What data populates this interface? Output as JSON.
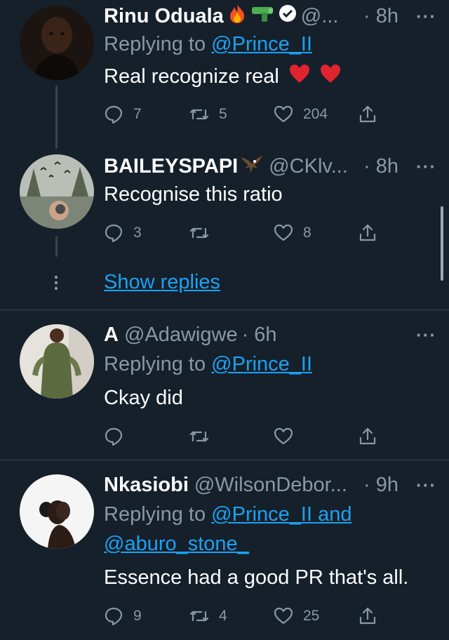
{
  "tweets": [
    {
      "name": "Rinu Oduala",
      "handle": "@...",
      "time": "· 8h",
      "replying_prefix": "Replying to ",
      "replying_to": "@Prince_II",
      "text": "Real recognize real",
      "replies": "7",
      "retweets": "5",
      "likes": "204",
      "icons": [
        "fire-emoji",
        "water-pistol-emoji",
        "verified-badge",
        "heart-emoji"
      ]
    },
    {
      "name": "BAILEYSPAPI",
      "handle": "@CKlv...",
      "time": "· 8h",
      "text": "Recognise this ratio",
      "replies": "3",
      "retweets": "",
      "likes": "8",
      "icons": [
        "eagle-emoji"
      ]
    },
    {
      "name": "A",
      "handle": "@Adawigwe",
      "time": "· 6h",
      "replying_prefix": "Replying to ",
      "replying_to": "@Prince_II",
      "text": "Ckay did",
      "replies": "",
      "retweets": "",
      "likes": ""
    },
    {
      "name": "Nkasiobi",
      "handle": "@WilsonDebor...",
      "time": "· 9h",
      "replying_prefix": "Replying to ",
      "replying_to": "@Prince_II and",
      "replying_to_2": "@aburo_stone_",
      "text": "Essence had a good PR that's all.",
      "replies": "9",
      "retweets": "4",
      "likes": "25"
    }
  ],
  "show_replies": "Show replies",
  "more_glyph": "···",
  "colors": {
    "background": "#15202b",
    "accent": "#1da1f2",
    "muted": "#8899a6",
    "divider": "#38444d"
  }
}
